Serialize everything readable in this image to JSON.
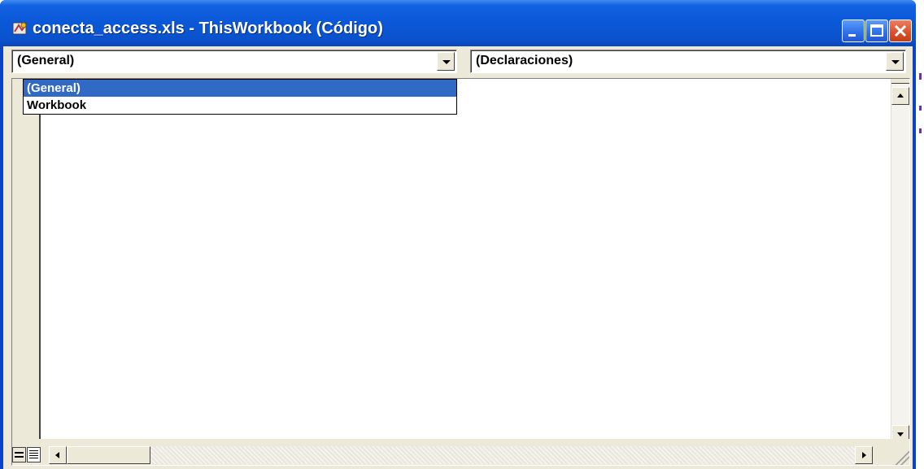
{
  "window": {
    "title": "conecta_access.xls - ThisWorkbook (Código)",
    "title_color": "#ffffff",
    "titlebar_color": "#0a58d8"
  },
  "caption_buttons": [
    {
      "name": "minimize",
      "icon": "minimize-icon"
    },
    {
      "name": "maximize",
      "icon": "maximize-icon"
    },
    {
      "name": "close",
      "icon": "close-icon"
    }
  ],
  "object_combo": {
    "value": "(General)"
  },
  "procedure_combo": {
    "value": "(Declaraciones)"
  },
  "dropdown": {
    "items": [
      "(General)",
      "Workbook"
    ],
    "selected_index": 0,
    "highlight_color": "#316ac5"
  },
  "bottom_bar": {
    "procedure_view_icon": "procedure-view-icon",
    "full_module_view_icon": "full-module-view-icon"
  }
}
